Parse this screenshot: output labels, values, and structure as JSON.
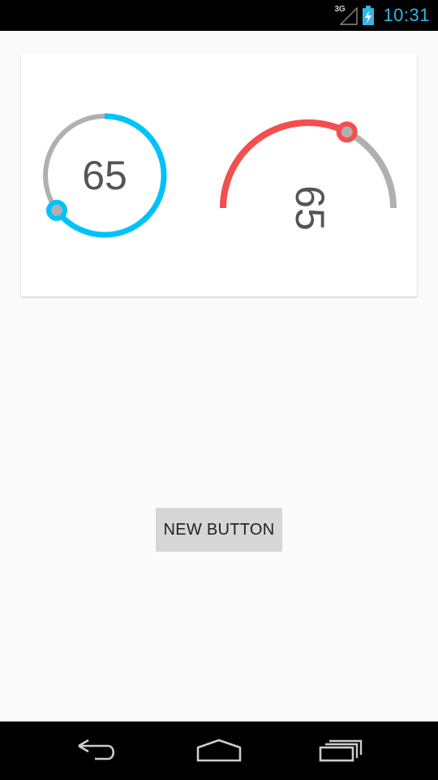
{
  "status_bar": {
    "network": "3G",
    "time": "10:31",
    "icons": [
      "signal-3g-icon",
      "battery-charging-icon"
    ]
  },
  "seekbars": {
    "circular": {
      "value": 65,
      "max": 100,
      "display": "65",
      "progress_color": "#00c2fa",
      "track_color": "#b0b0b0"
    },
    "semicircular": {
      "value": 65,
      "max": 100,
      "display": "65",
      "progress_color": "#f54e4e",
      "track_color": "#b0b0b0"
    }
  },
  "new_button": {
    "label": "NEW BUTTON"
  },
  "nav_bar": {
    "icons": [
      "back-icon",
      "home-icon",
      "recent-apps-icon"
    ]
  }
}
